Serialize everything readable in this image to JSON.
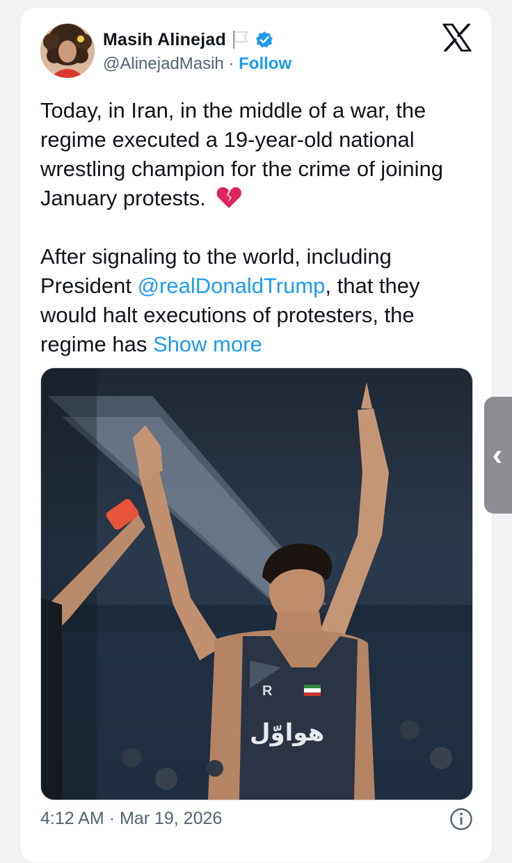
{
  "author": {
    "name": "Masih Alinejad",
    "handle": "@AlinejadMasih",
    "separator": "·",
    "follow_label": "Follow"
  },
  "icons": {
    "flag": "white-flag-icon",
    "verified": "verified-badge-icon",
    "platform": "x-logo-icon",
    "heart": "broken-heart-icon",
    "info": "info-icon",
    "side_tab": "chevron-left-icon"
  },
  "tweet": {
    "para1": "Today, in Iran, in the middle of a war, the regime executed a 19-year-old national wrestling champion for the crime of joining January protests.",
    "para2_a": "After signaling to the world, including President ",
    "mention": "@realDonaldTrump",
    "para2_b": ", that they would halt executions of protesters, the regime has ",
    "show_more": "Show more"
  },
  "photo": {
    "singlet_brand": "R",
    "singlet_text": "هواوّل"
  },
  "footer": {
    "time": "4:12 AM",
    "separator": "·",
    "date": "Mar 19, 2026"
  },
  "side_tab": {
    "glyph": "‹"
  },
  "colors": {
    "accent": "#1d9bf0",
    "text": "#0f1419",
    "muted": "#536471",
    "verified": "#1d9bf0",
    "broken_heart": "#e0245e"
  }
}
